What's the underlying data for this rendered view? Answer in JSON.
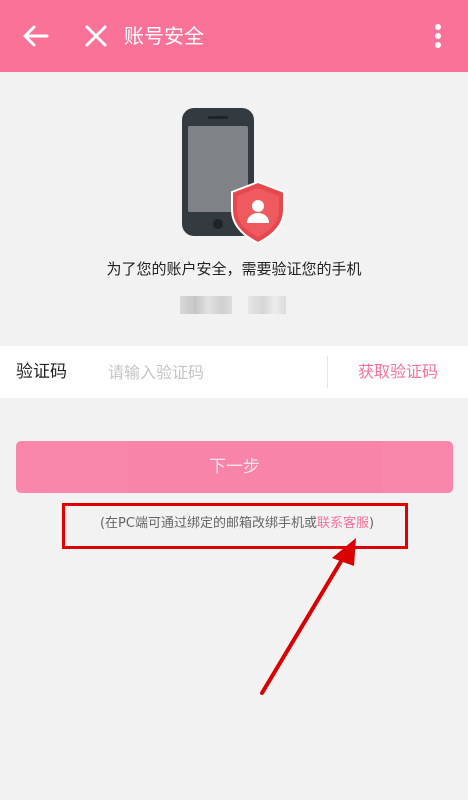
{
  "appbar": {
    "title": "账号安全",
    "back_icon": "arrow-left-icon",
    "close_icon": "close-icon",
    "more_icon": "more-vertical-icon"
  },
  "hero": {
    "icon": "phone-with-shield-user-icon",
    "description": "为了您的账户安全，需要验证您的手机"
  },
  "verify": {
    "label": "验证码",
    "input_placeholder": "请输入验证码",
    "input_value": "",
    "get_code": "获取验证码"
  },
  "next": {
    "label": "下一步"
  },
  "hint": {
    "prefix": "(在PC端可通过绑定的邮箱改绑手机或",
    "link": "联系客服",
    "suffix": ")"
  },
  "colors": {
    "accent": "#fb7299",
    "annotation": "#e00000",
    "background": "#f2f2f2"
  }
}
